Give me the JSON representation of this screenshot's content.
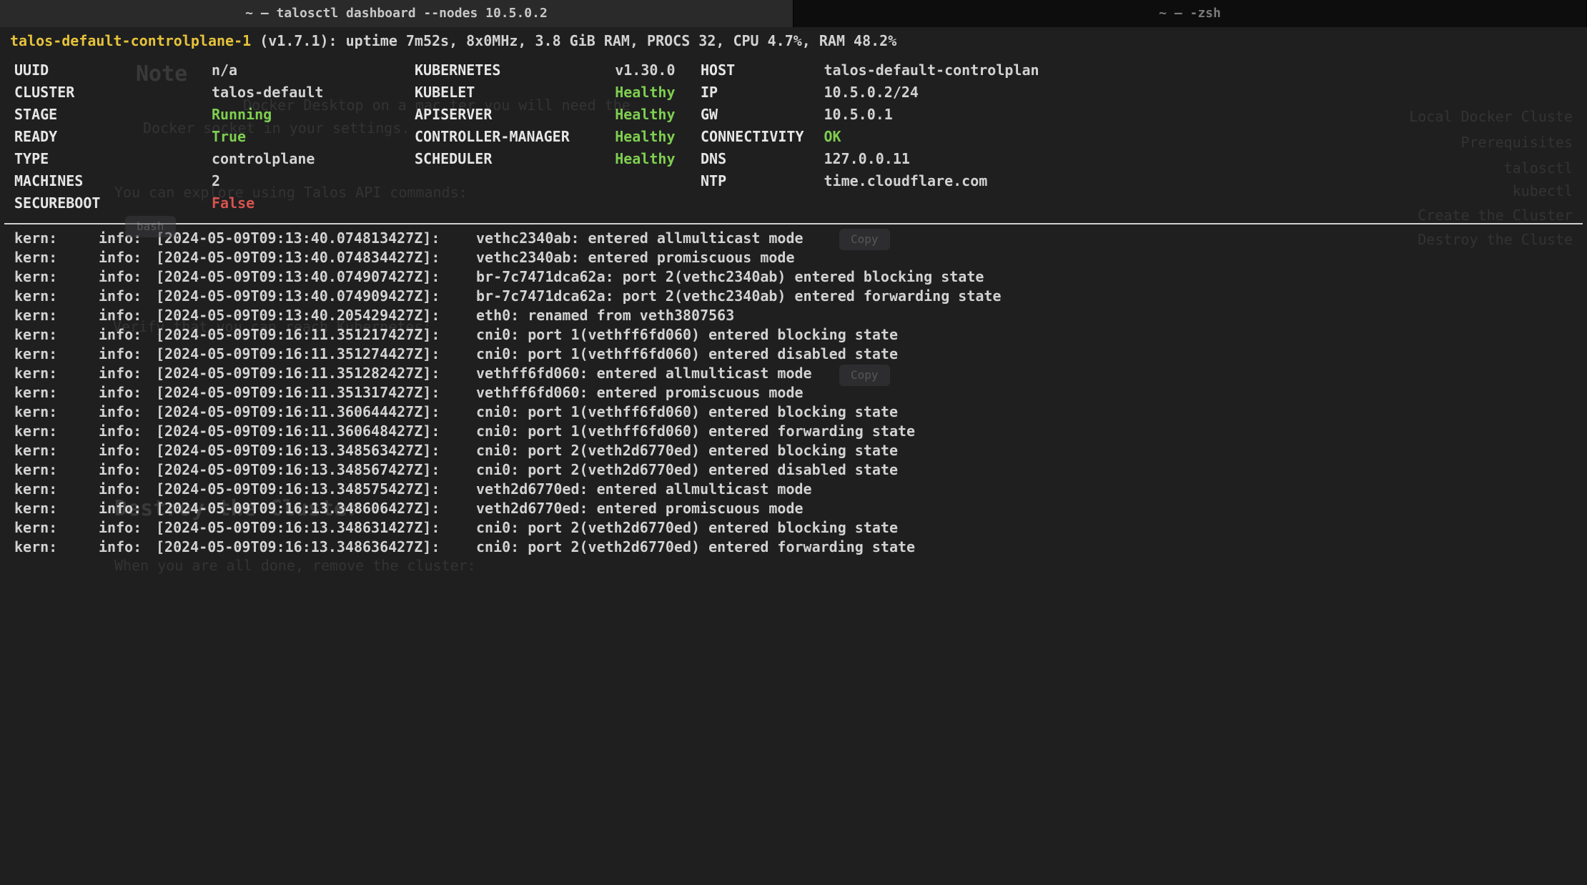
{
  "tabs": {
    "active": "~ — talosctl dashboard --nodes 10.5.0.2",
    "inactive": "~ — -zsh"
  },
  "header": {
    "node_name": "talos-default-controlplane-1",
    "rest": " (v1.7.1): uptime 7m52s, 8x0MHz, 3.8 GiB RAM, PROCS 32, CPU 4.7%, RAM 48.2%"
  },
  "group1": [
    {
      "label": "UUID",
      "value": "n/a"
    },
    {
      "label": "CLUSTER",
      "value": "talos-default"
    },
    {
      "label": "STAGE",
      "value": "Running",
      "cls": "green"
    },
    {
      "label": "READY",
      "value": "True",
      "cls": "green"
    },
    {
      "label": "TYPE",
      "value": "controlplane"
    },
    {
      "label": "MACHINES",
      "value": "2"
    },
    {
      "label": "SECUREBOOT",
      "value": "False",
      "cls": "red"
    }
  ],
  "group2": [
    {
      "label": "KUBERNETES",
      "value": "v1.30.0"
    },
    {
      "label": "KUBELET",
      "value": "Healthy",
      "cls": "green"
    },
    {
      "label": "APISERVER",
      "value": "Healthy",
      "cls": "green"
    },
    {
      "label": "CONTROLLER-MANAGER",
      "value": "Healthy",
      "cls": "green"
    },
    {
      "label": "SCHEDULER",
      "value": "Healthy",
      "cls": "green"
    }
  ],
  "group3": [
    {
      "label": "HOST",
      "value": "talos-default-controlplan"
    },
    {
      "label": "IP",
      "value": "10.5.0.2/24"
    },
    {
      "label": "GW",
      "value": "10.5.0.1"
    },
    {
      "label": "CONNECTIVITY",
      "value": "OK",
      "cls": "green"
    },
    {
      "label": "DNS",
      "value": "127.0.0.11"
    },
    {
      "label": "NTP",
      "value": "time.cloudflare.com"
    }
  ],
  "logs": [
    {
      "fac": "kern:",
      "lvl": "info:",
      "ts": "[2024-05-09T09:13:40.074813427Z]:",
      "msg": "vethc2340ab: entered allmulticast mode"
    },
    {
      "fac": "kern:",
      "lvl": "info:",
      "ts": "[2024-05-09T09:13:40.074834427Z]:",
      "msg": "vethc2340ab: entered promiscuous mode"
    },
    {
      "fac": "kern:",
      "lvl": "info:",
      "ts": "[2024-05-09T09:13:40.074907427Z]:",
      "msg": "br-7c7471dca62a: port 2(vethc2340ab) entered blocking state"
    },
    {
      "fac": "kern:",
      "lvl": "info:",
      "ts": "[2024-05-09T09:13:40.074909427Z]:",
      "msg": "br-7c7471dca62a: port 2(vethc2340ab) entered forwarding state"
    },
    {
      "fac": "kern:",
      "lvl": "info:",
      "ts": "[2024-05-09T09:13:40.205429427Z]:",
      "msg": "eth0: renamed from veth3807563"
    },
    {
      "fac": "kern:",
      "lvl": "info:",
      "ts": "[2024-05-09T09:16:11.351217427Z]:",
      "msg": "cni0: port 1(vethff6fd060) entered blocking state"
    },
    {
      "fac": "kern:",
      "lvl": "info:",
      "ts": "[2024-05-09T09:16:11.351274427Z]:",
      "msg": "cni0: port 1(vethff6fd060) entered disabled state"
    },
    {
      "fac": "kern:",
      "lvl": "info:",
      "ts": "[2024-05-09T09:16:11.351282427Z]:",
      "msg": "vethff6fd060: entered allmulticast mode"
    },
    {
      "fac": "kern:",
      "lvl": "info:",
      "ts": "[2024-05-09T09:16:11.351317427Z]:",
      "msg": "vethff6fd060: entered promiscuous mode"
    },
    {
      "fac": "kern:",
      "lvl": "info:",
      "ts": "[2024-05-09T09:16:11.360644427Z]:",
      "msg": "cni0: port 1(vethff6fd060) entered blocking state"
    },
    {
      "fac": "kern:",
      "lvl": "info:",
      "ts": "[2024-05-09T09:16:11.360648427Z]:",
      "msg": "cni0: port 1(vethff6fd060) entered forwarding state"
    },
    {
      "fac": "kern:",
      "lvl": "info:",
      "ts": "[2024-05-09T09:16:13.348563427Z]:",
      "msg": "cni0: port 2(veth2d6770ed) entered blocking state"
    },
    {
      "fac": "kern:",
      "lvl": "info:",
      "ts": "[2024-05-09T09:16:13.348567427Z]:",
      "msg": "cni0: port 2(veth2d6770ed) entered disabled state"
    },
    {
      "fac": "kern:",
      "lvl": "info:",
      "ts": "[2024-05-09T09:16:13.348575427Z]:",
      "msg": "veth2d6770ed: entered allmulticast mode"
    },
    {
      "fac": "kern:",
      "lvl": "info:",
      "ts": "[2024-05-09T09:16:13.348606427Z]:",
      "msg": "veth2d6770ed: entered promiscuous mode"
    },
    {
      "fac": "kern:",
      "lvl": "info:",
      "ts": "[2024-05-09T09:16:13.348631427Z]:",
      "msg": "cni0: port 2(veth2d6770ed) entered blocking state"
    },
    {
      "fac": "kern:",
      "lvl": "info:",
      "ts": "[2024-05-09T09:16:13.348636427Z]:",
      "msg": "cni0: port 2(veth2d6770ed) entered forwarding state"
    }
  ],
  "ghost": {
    "note_heading": "Note",
    "note_line1": "Docker Desktop on a mac        ter you will need        the",
    "note_line2": "Docker socket in your settings.",
    "explore": "You can explore using Talos API commands:",
    "bash_pill": "bash",
    "copy_pill": "Copy",
    "verify": "Verify that you can reach Kubernetes:",
    "destroy_heading": "Destroy the Cluster",
    "when_done": "When you are all done, remove the cluster:",
    "right_items": [
      "Local Docker Cluste",
      "Prerequisites",
      "talosctl",
      "kubectl",
      "Create the Cluster",
      "Destroy the Cluste"
    ]
  }
}
